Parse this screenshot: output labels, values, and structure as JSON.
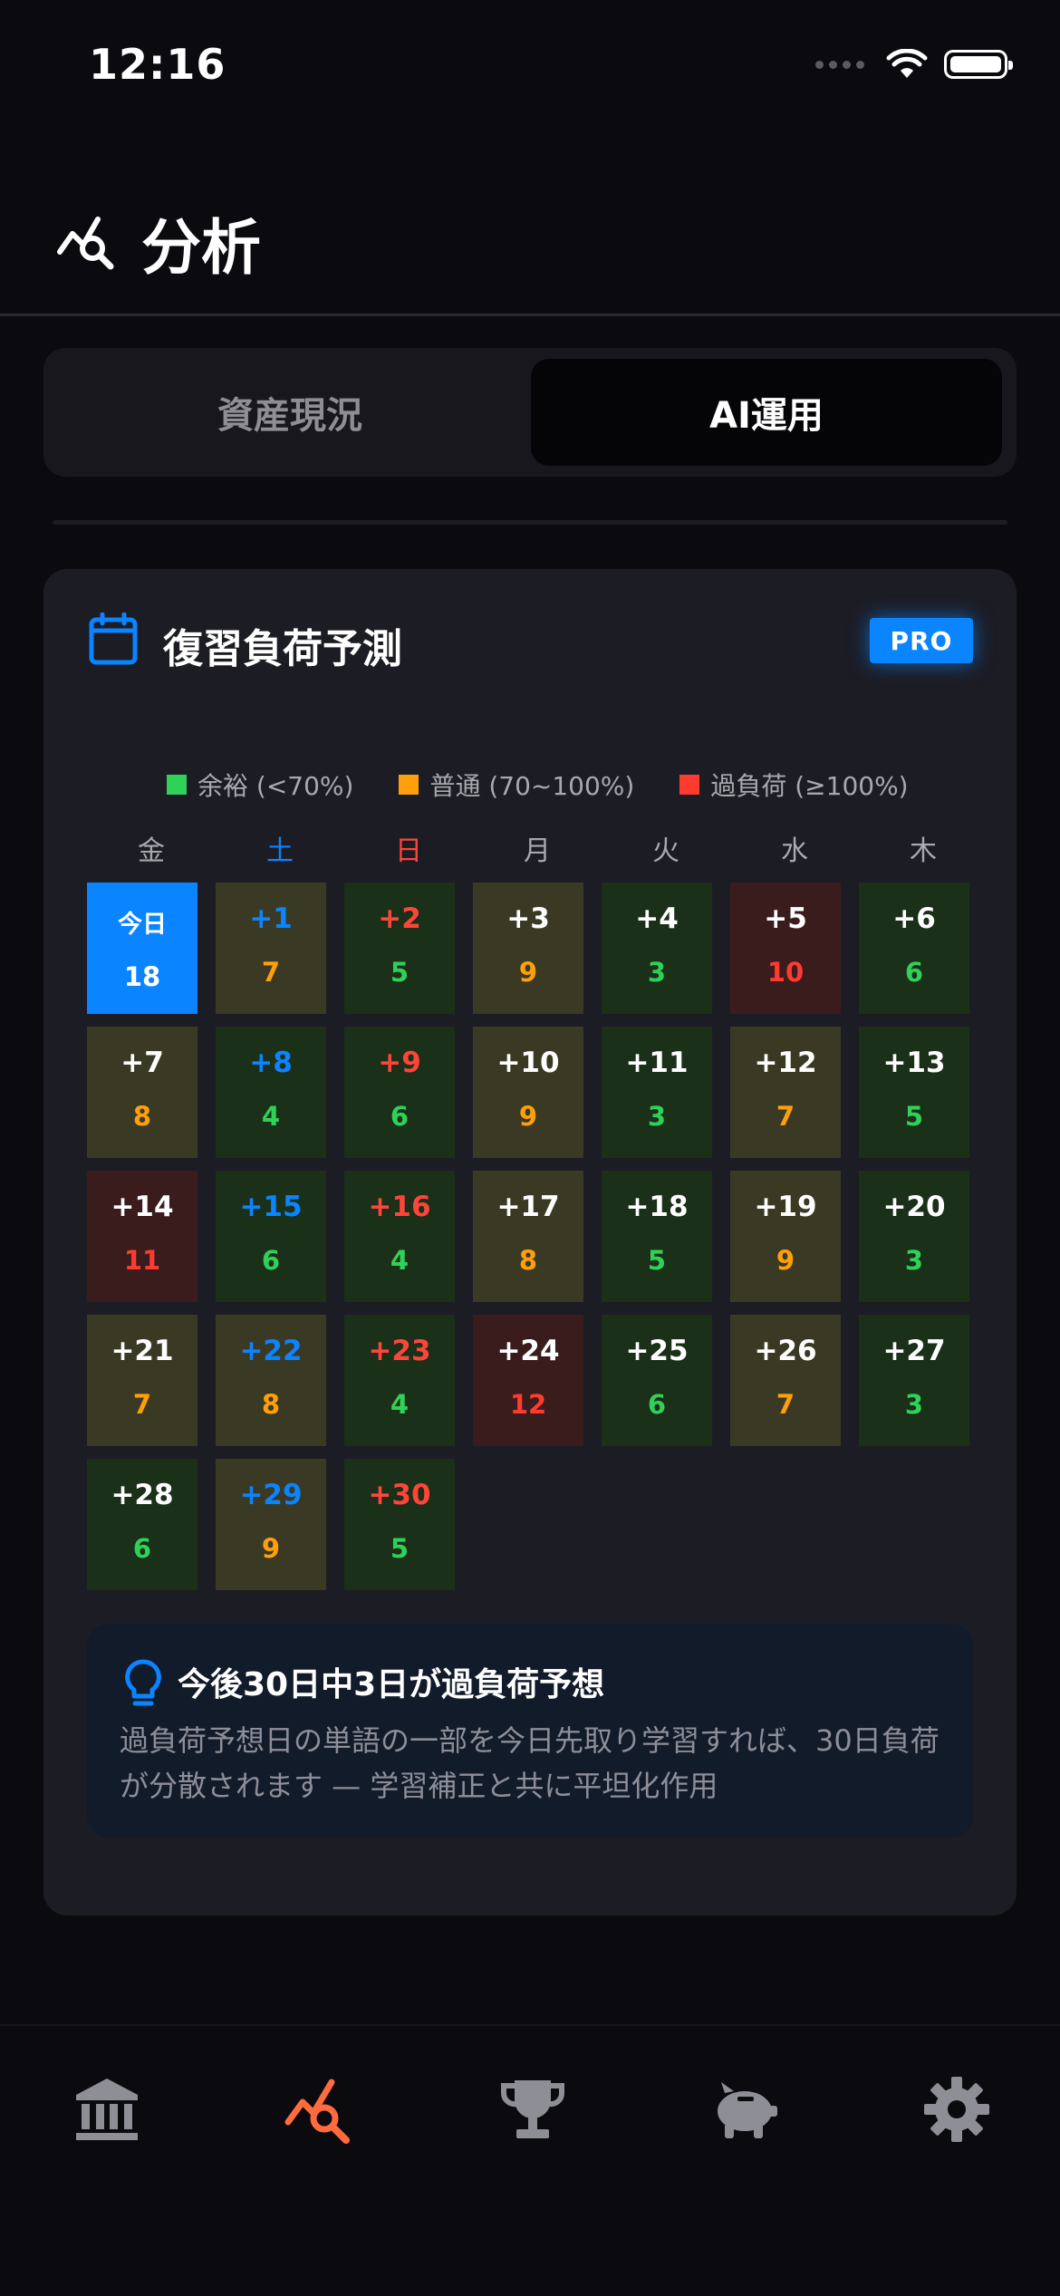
{
  "status_bar": {
    "time": "12:16"
  },
  "header": {
    "title": "分析"
  },
  "segment": {
    "left_label": "資産現況",
    "right_label": "AI運用"
  },
  "card": {
    "title": "復習負荷予測",
    "badge": "PRO",
    "legend": [
      {
        "label": "余裕 (<70%)",
        "color": "#30d158"
      },
      {
        "label": "普通 (70~100%)",
        "color": "#ff9f0a"
      },
      {
        "label": "過負荷 (≥100%)",
        "color": "#ff3b30"
      }
    ],
    "weekdays": [
      "金",
      "土",
      "日",
      "月",
      "火",
      "水",
      "木"
    ],
    "days": [
      {
        "offset": "今日",
        "count": "18",
        "level": "today"
      },
      {
        "offset": "+1",
        "count": "7",
        "level": "normal"
      },
      {
        "offset": "+2",
        "count": "5",
        "level": "low"
      },
      {
        "offset": "+3",
        "count": "9",
        "level": "normal"
      },
      {
        "offset": "+4",
        "count": "3",
        "level": "low"
      },
      {
        "offset": "+5",
        "count": "10",
        "level": "over"
      },
      {
        "offset": "+6",
        "count": "6",
        "level": "low"
      },
      {
        "offset": "+7",
        "count": "8",
        "level": "normal"
      },
      {
        "offset": "+8",
        "count": "4",
        "level": "low"
      },
      {
        "offset": "+9",
        "count": "6",
        "level": "low"
      },
      {
        "offset": "+10",
        "count": "9",
        "level": "normal"
      },
      {
        "offset": "+11",
        "count": "3",
        "level": "low"
      },
      {
        "offset": "+12",
        "count": "7",
        "level": "normal"
      },
      {
        "offset": "+13",
        "count": "5",
        "level": "low"
      },
      {
        "offset": "+14",
        "count": "11",
        "level": "over"
      },
      {
        "offset": "+15",
        "count": "6",
        "level": "low"
      },
      {
        "offset": "+16",
        "count": "4",
        "level": "low"
      },
      {
        "offset": "+17",
        "count": "8",
        "level": "normal"
      },
      {
        "offset": "+18",
        "count": "5",
        "level": "low"
      },
      {
        "offset": "+19",
        "count": "9",
        "level": "normal"
      },
      {
        "offset": "+20",
        "count": "3",
        "level": "low"
      },
      {
        "offset": "+21",
        "count": "7",
        "level": "normal"
      },
      {
        "offset": "+22",
        "count": "8",
        "level": "normal"
      },
      {
        "offset": "+23",
        "count": "4",
        "level": "low"
      },
      {
        "offset": "+24",
        "count": "12",
        "level": "over"
      },
      {
        "offset": "+25",
        "count": "6",
        "level": "low"
      },
      {
        "offset": "+26",
        "count": "7",
        "level": "normal"
      },
      {
        "offset": "+27",
        "count": "3",
        "level": "low"
      },
      {
        "offset": "+28",
        "count": "6",
        "level": "low"
      },
      {
        "offset": "+29",
        "count": "9",
        "level": "normal"
      },
      {
        "offset": "+30",
        "count": "5",
        "level": "low"
      }
    ]
  },
  "tip": {
    "title": "今後30日中3日が過負荷予想",
    "body": "過負荷予想日の単語の一部を今日先取り学習すれば、30日負荷が分散されます — 学習補正と共に平坦化作用"
  },
  "colors": {
    "accent": "#0a84ff",
    "active_tab": "#ff6b3d",
    "low_bg": "#1a3019",
    "low_text": "#30d158",
    "normal_bg": "#3a3a24",
    "normal_text": "#ff9f0a",
    "over_bg": "#3a1c1c",
    "over_text": "#ff3b30",
    "saturday": "#0a84ff",
    "sunday": "#ff453a"
  },
  "tabbar": {
    "items": [
      {
        "icon": "bank-icon",
        "active": false
      },
      {
        "icon": "analytics-icon",
        "active": true
      },
      {
        "icon": "trophy-icon",
        "active": false
      },
      {
        "icon": "piggy-bank-icon",
        "active": false
      },
      {
        "icon": "gear-icon",
        "active": false
      }
    ]
  }
}
